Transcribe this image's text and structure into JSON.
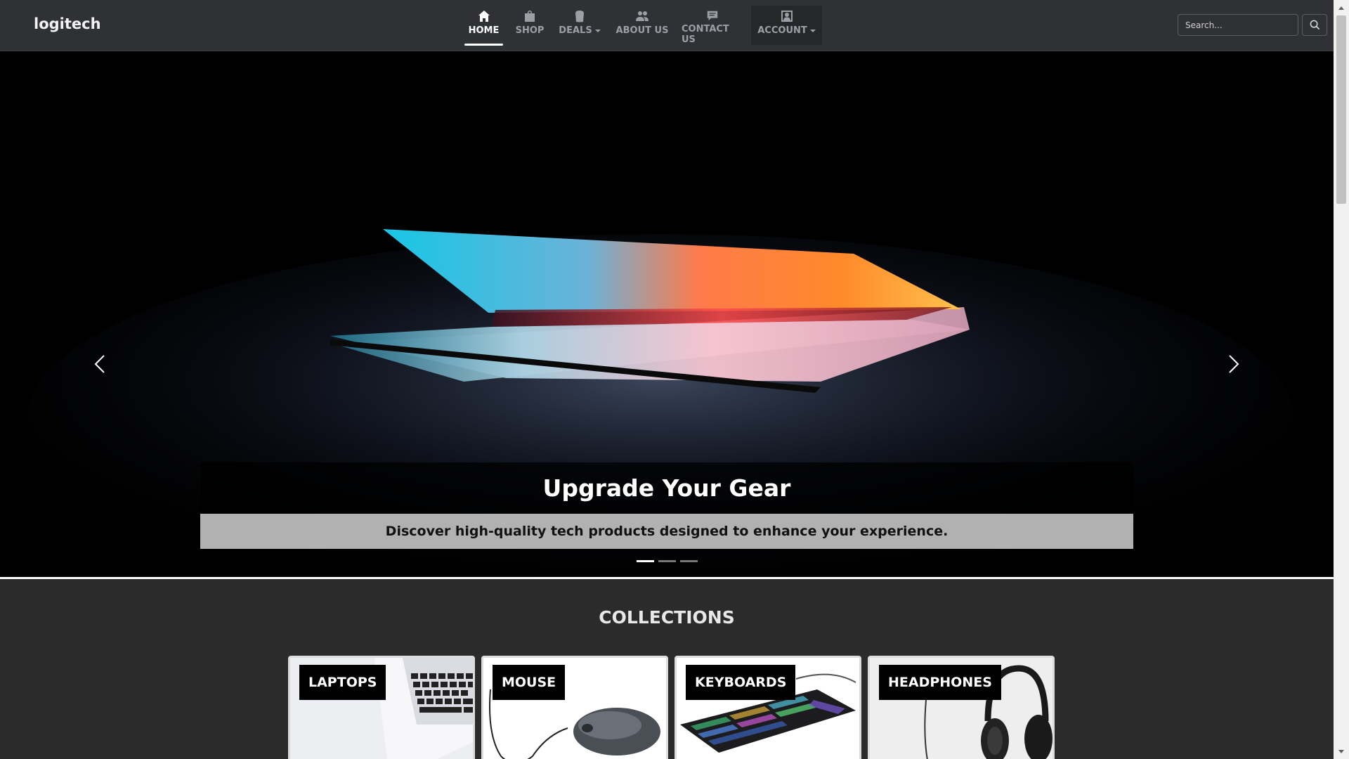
{
  "brand": "logitech",
  "nav": {
    "home": {
      "label": "HOME",
      "icon": "home-icon"
    },
    "shop": {
      "label": "SHOP",
      "icon": "shopping-bag-icon"
    },
    "deals": {
      "label": "DEALS",
      "icon": "bucket-icon"
    },
    "about": {
      "label": "ABOUT US",
      "icon": "people-icon"
    },
    "contact": {
      "label": "CONTACT US",
      "icon": "chat-icon"
    },
    "account": {
      "label": "ACCOUNT",
      "icon": "user-icon"
    }
  },
  "search": {
    "placeholder": "Search..."
  },
  "hero": {
    "title": "Upgrade Your Gear",
    "subtitle": "Discover high-quality tech products designed to enhance your experience.",
    "slide_count": 3,
    "active_slide": 1
  },
  "collections": {
    "title": "COLLECTIONS",
    "items": [
      {
        "label": "LAPTOPS"
      },
      {
        "label": "MOUSE"
      },
      {
        "label": "KEYBOARDS"
      },
      {
        "label": "HEADPHONES"
      }
    ]
  },
  "colors": {
    "navbar": "#2f3135",
    "page_background": "#2b2b2b",
    "subtitle_band": "#b1b1b1"
  }
}
